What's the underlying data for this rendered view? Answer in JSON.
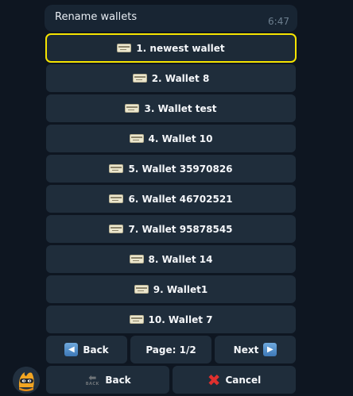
{
  "message": {
    "text": "Rename wallets",
    "time": "6:47"
  },
  "wallets": [
    {
      "label": "1. newest wallet",
      "icon": "wallet-icon"
    },
    {
      "label": "2. Wallet 8",
      "icon": "wallet-icon"
    },
    {
      "label": "3. Wallet test",
      "icon": "wallet-icon"
    },
    {
      "label": "4. Wallet 10",
      "icon": "wallet-icon"
    },
    {
      "label": "5. Wallet 35970826",
      "icon": "wallet-icon"
    },
    {
      "label": "6. Wallet 46702521",
      "icon": "wallet-icon"
    },
    {
      "label": "7. Wallet 95878545",
      "icon": "wallet-icon"
    },
    {
      "label": "8. Wallet 14",
      "icon": "wallet-icon"
    },
    {
      "label": "9. Wallet1",
      "icon": "wallet-icon"
    },
    {
      "label": "10. Wallet 7",
      "icon": "wallet-icon"
    }
  ],
  "pagination": {
    "back_label": "Back",
    "page_label": "Page: 1/2",
    "next_label": "Next"
  },
  "footer": {
    "back_label": "Back",
    "back_icon_text": "BACK",
    "cancel_label": "Cancel"
  },
  "colors": {
    "highlight": "#f5e400",
    "cancel_icon": "#e0302e",
    "arrow_icon": "#4a88c8"
  }
}
